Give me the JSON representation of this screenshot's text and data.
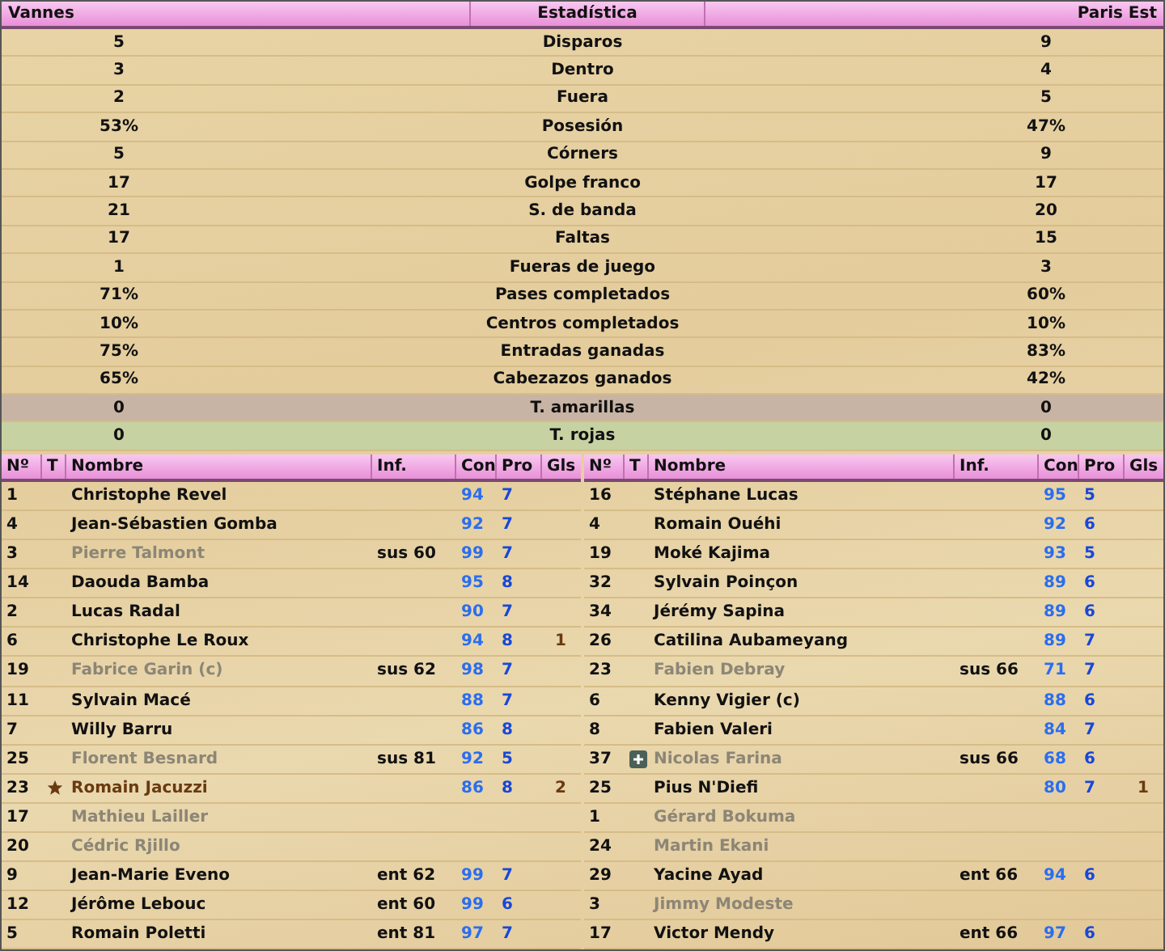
{
  "stats": {
    "home_team": "Vannes",
    "title": "Estadística",
    "away_team": "Paris Est",
    "rows": [
      {
        "home": "5",
        "label": "Disparos",
        "away": "9",
        "kind": "normal"
      },
      {
        "home": "3",
        "label": "Dentro",
        "away": "4",
        "kind": "normal"
      },
      {
        "home": "2",
        "label": "Fuera",
        "away": "5",
        "kind": "normal"
      },
      {
        "home": "53%",
        "label": "Posesión",
        "away": "47%",
        "kind": "normal"
      },
      {
        "home": "5",
        "label": "Córners",
        "away": "9",
        "kind": "normal"
      },
      {
        "home": "17",
        "label": "Golpe franco",
        "away": "17",
        "kind": "normal"
      },
      {
        "home": "21",
        "label": "S. de banda",
        "away": "20",
        "kind": "normal"
      },
      {
        "home": "17",
        "label": "Faltas",
        "away": "15",
        "kind": "normal"
      },
      {
        "home": "1",
        "label": "Fueras de juego",
        "away": "3",
        "kind": "normal"
      },
      {
        "home": "71%",
        "label": "Pases completados",
        "away": "60%",
        "kind": "normal"
      },
      {
        "home": "10%",
        "label": "Centros completados",
        "away": "10%",
        "kind": "normal"
      },
      {
        "home": "75%",
        "label": "Entradas ganadas",
        "away": "83%",
        "kind": "normal"
      },
      {
        "home": "65%",
        "label": "Cabezazos ganados",
        "away": "42%",
        "kind": "normal"
      },
      {
        "home": "0",
        "label": "T. amarillas",
        "away": "0",
        "kind": "yellow"
      },
      {
        "home": "0",
        "label": "T. rojas",
        "away": "0",
        "kind": "red"
      }
    ]
  },
  "lineups": [
    {
      "columns": [
        "Nº",
        "T",
        "Nombre",
        "Inf.",
        "Con",
        "Pro",
        "Gls"
      ],
      "players": [
        {
          "number": "1",
          "kind": "plain",
          "name": "Christophe Revel",
          "dimmed": false,
          "highlighted": false,
          "con": "94",
          "pro": "7"
        },
        {
          "number": "4",
          "kind": "plain",
          "name": "Jean-Sébastien Gomba",
          "dimmed": false,
          "highlighted": false,
          "con": "92",
          "pro": "7"
        },
        {
          "number": "3",
          "kind": "plain",
          "name": "Pierre Talmont",
          "dimmed": true,
          "highlighted": false,
          "info": "sus 60",
          "con": "99",
          "pro": "7"
        },
        {
          "number": "14",
          "kind": "plain",
          "name": "Daouda Bamba",
          "dimmed": false,
          "highlighted": false,
          "con": "95",
          "pro": "8"
        },
        {
          "number": "2",
          "kind": "plain",
          "name": "Lucas Radal",
          "dimmed": false,
          "highlighted": false,
          "con": "90",
          "pro": "7"
        },
        {
          "number": "6",
          "kind": "plain",
          "name": "Christophe Le Roux",
          "dimmed": false,
          "highlighted": false,
          "con": "94",
          "pro": "8",
          "goals": "1"
        },
        {
          "number": "19",
          "kind": "plain",
          "name": "Fabrice Garin (c)",
          "dimmed": true,
          "highlighted": false,
          "info": "sus 62",
          "con": "98",
          "pro": "7"
        },
        {
          "number": "11",
          "kind": "plain",
          "name": "Sylvain Macé",
          "dimmed": false,
          "highlighted": false,
          "con": "88",
          "pro": "7"
        },
        {
          "number": "7",
          "kind": "plain",
          "name": "Willy Barru",
          "dimmed": false,
          "highlighted": false,
          "con": "86",
          "pro": "8"
        },
        {
          "number": "25",
          "kind": "plain",
          "name": "Florent Besnard",
          "dimmed": true,
          "highlighted": false,
          "info": "sus 81",
          "con": "92",
          "pro": "5"
        },
        {
          "number": "23",
          "kind": "star",
          "name": "Romain Jacuzzi",
          "dimmed": false,
          "highlighted": true,
          "con": "86",
          "pro": "8",
          "goals": "2"
        },
        {
          "number": "17",
          "kind": "plain",
          "name": "Mathieu Lailler",
          "dimmed": true,
          "highlighted": false
        },
        {
          "number": "20",
          "kind": "plain",
          "name": "Cédric Rjillo",
          "dimmed": true,
          "highlighted": false
        },
        {
          "number": "9",
          "kind": "plain",
          "name": "Jean-Marie Eveno",
          "dimmed": false,
          "highlighted": false,
          "info": "ent 62",
          "con": "99",
          "pro": "7"
        },
        {
          "number": "12",
          "kind": "plain",
          "name": "Jérôme Lebouc",
          "dimmed": false,
          "highlighted": false,
          "info": "ent 60",
          "con": "99",
          "pro": "6"
        },
        {
          "number": "5",
          "kind": "plain",
          "name": "Romain Poletti",
          "dimmed": false,
          "highlighted": false,
          "info": "ent 81",
          "con": "97",
          "pro": "7"
        }
      ]
    },
    {
      "columns": [
        "Nº",
        "T",
        "Nombre",
        "Inf.",
        "Con",
        "Pro",
        "Gls"
      ],
      "players": [
        {
          "number": "16",
          "kind": "plain",
          "name": "Stéphane Lucas",
          "dimmed": false,
          "highlighted": false,
          "con": "95",
          "pro": "5"
        },
        {
          "number": "4",
          "kind": "plain",
          "name": "Romain Ouéhi",
          "dimmed": false,
          "highlighted": false,
          "con": "92",
          "pro": "6"
        },
        {
          "number": "19",
          "kind": "plain",
          "name": "Moké Kajima",
          "dimmed": false,
          "highlighted": false,
          "con": "93",
          "pro": "5"
        },
        {
          "number": "32",
          "kind": "plain",
          "name": "Sylvain Poinçon",
          "dimmed": false,
          "highlighted": false,
          "con": "89",
          "pro": "6"
        },
        {
          "number": "34",
          "kind": "plain",
          "name": "Jérémy Sapina",
          "dimmed": false,
          "highlighted": false,
          "con": "89",
          "pro": "6"
        },
        {
          "number": "26",
          "kind": "plain",
          "name": "Catilina Aubameyang",
          "dimmed": false,
          "highlighted": false,
          "con": "89",
          "pro": "7"
        },
        {
          "number": "23",
          "kind": "plain",
          "name": "Fabien Debray",
          "dimmed": true,
          "highlighted": false,
          "info": "sus 66",
          "con": "71",
          "pro": "7"
        },
        {
          "number": "6",
          "kind": "plain",
          "name": "Kenny Vigier (c)",
          "dimmed": false,
          "highlighted": false,
          "con": "88",
          "pro": "6"
        },
        {
          "number": "8",
          "kind": "plain",
          "name": "Fabien Valeri",
          "dimmed": false,
          "highlighted": false,
          "con": "84",
          "pro": "7"
        },
        {
          "number": "37",
          "kind": "injury",
          "name": "Nicolas Farina",
          "dimmed": true,
          "highlighted": false,
          "info": "sus 66",
          "con": "68",
          "pro": "6"
        },
        {
          "number": "25",
          "kind": "plain",
          "name": "Pius N'Diefi",
          "dimmed": false,
          "highlighted": false,
          "con": "80",
          "pro": "7",
          "goals": "1"
        },
        {
          "number": "1",
          "kind": "plain",
          "name": "Gérard Bokuma",
          "dimmed": true,
          "highlighted": false
        },
        {
          "number": "24",
          "kind": "plain",
          "name": "Martin Ekani",
          "dimmed": true,
          "highlighted": false
        },
        {
          "number": "29",
          "kind": "plain",
          "name": "Yacine Ayad",
          "dimmed": false,
          "highlighted": false,
          "info": "ent 66",
          "con": "94",
          "pro": "6"
        },
        {
          "number": "3",
          "kind": "plain",
          "name": "Jimmy Modeste",
          "dimmed": true,
          "highlighted": false
        },
        {
          "number": "17",
          "kind": "plain",
          "name": "Victor Mendy",
          "dimmed": false,
          "highlighted": false,
          "info": "ent 66",
          "con": "97",
          "pro": "6"
        }
      ]
    }
  ]
}
